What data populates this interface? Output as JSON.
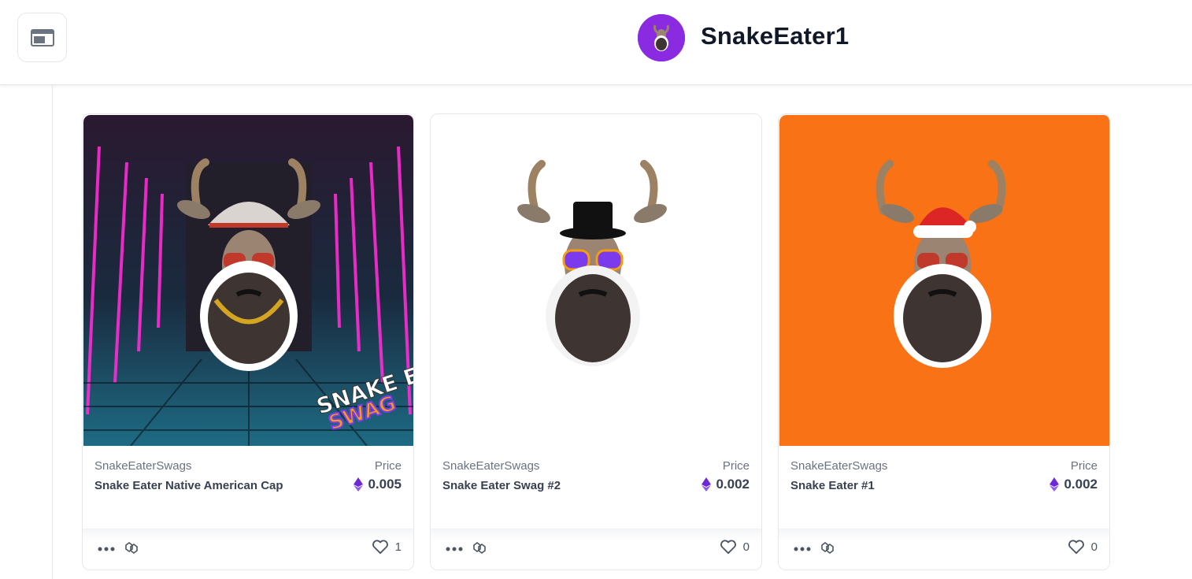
{
  "header": {
    "username": "SnakeEater1",
    "icons": {
      "toggle": "layout-panel-icon",
      "avatar": "goat-avatar"
    }
  },
  "cards": [
    {
      "collection": "SnakeEaterSwags",
      "name": "Snake Eater Native American Cap",
      "price_label": "Price",
      "price": "0.005",
      "likes": "1",
      "image": "goat-headdress-neon-hallway",
      "image_text": "SNAKE EATER SWAG"
    },
    {
      "collection": "SnakeEaterSwags",
      "name": "Snake Eater Swag #2",
      "price_label": "Price",
      "price": "0.002",
      "likes": "0",
      "image": "goat-top-hat-white-background"
    },
    {
      "collection": "SnakeEaterSwags",
      "name": "Snake Eater #1",
      "price_label": "Price",
      "price": "0.002",
      "likes": "0",
      "image": "goat-santa-hat-orange-background"
    }
  ],
  "colors": {
    "accent": "#8a2be2",
    "orange_bg": "#f97316",
    "eth": "#6d28d9"
  }
}
